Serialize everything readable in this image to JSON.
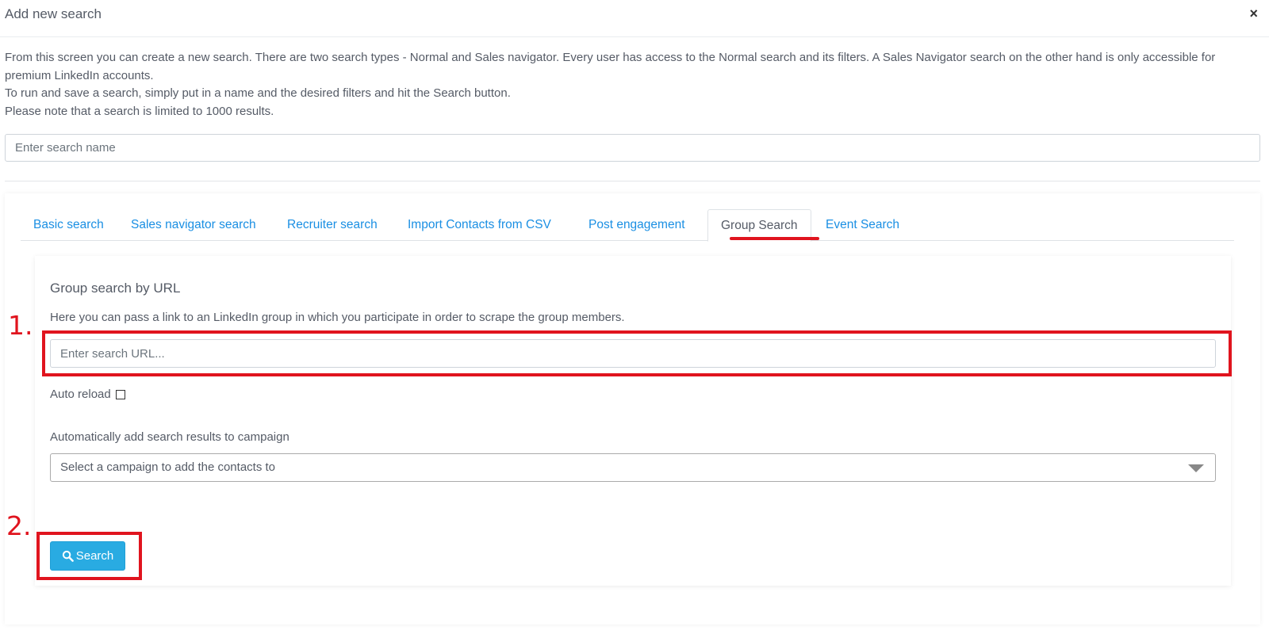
{
  "modal": {
    "title": "Add new search",
    "close_label": "×"
  },
  "description": {
    "line1": "From this screen you can create a new search. There are two search types - Normal and Sales navigator. Every user has access to the Normal search and its filters. A Sales Navigator search on the other hand is only accessible for premium LinkedIn accounts.",
    "line2": "To run and save a search, simply put in a name and the desired filters and hit the Search button.",
    "line3": "Please note that a search is limited to 1000 results."
  },
  "search_name": {
    "placeholder": "Enter search name",
    "value": ""
  },
  "tabs": [
    {
      "label": "Basic search"
    },
    {
      "label": "Sales navigator search"
    },
    {
      "label": "Recruiter search"
    },
    {
      "label": "Import Contacts from CSV"
    },
    {
      "label": "Post engagement"
    },
    {
      "label": "Group Search",
      "active": true
    },
    {
      "label": "Event Search"
    }
  ],
  "group_search": {
    "title": "Group search by URL",
    "description": "Here you can pass a link to an LinkedIn group in which you participate in order to scrape the group members.",
    "url_placeholder": "Enter search URL...",
    "url_value": "",
    "auto_reload_label": "Auto reload",
    "auto_reload_checked": false,
    "campaign_label": "Automatically add search results to campaign",
    "campaign_placeholder": "Select a campaign to add the contacts to",
    "search_button_label": "Search"
  },
  "annotations": {
    "marker1": "1.",
    "marker2": "2."
  },
  "colors": {
    "accent": "#29abe2",
    "link": "#1a8fe3",
    "annotation": "#e0141e",
    "text": "#555b66"
  },
  "icons": {
    "close": "close-icon",
    "search": "search-icon",
    "dropdown": "caret-down-icon"
  }
}
